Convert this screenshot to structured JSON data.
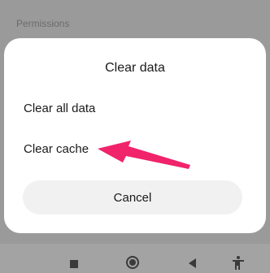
{
  "background": {
    "section_label": "Permissions"
  },
  "dialog": {
    "title": "Clear data",
    "options": [
      {
        "label": "Clear all data"
      },
      {
        "label": "Clear cache"
      }
    ],
    "cancel_label": "Cancel"
  },
  "nav_bar": {
    "icons": [
      "recents-icon",
      "home-icon",
      "back-icon",
      "accessibility-icon"
    ]
  },
  "annotation": {
    "arrow_color": "#f0236b"
  }
}
